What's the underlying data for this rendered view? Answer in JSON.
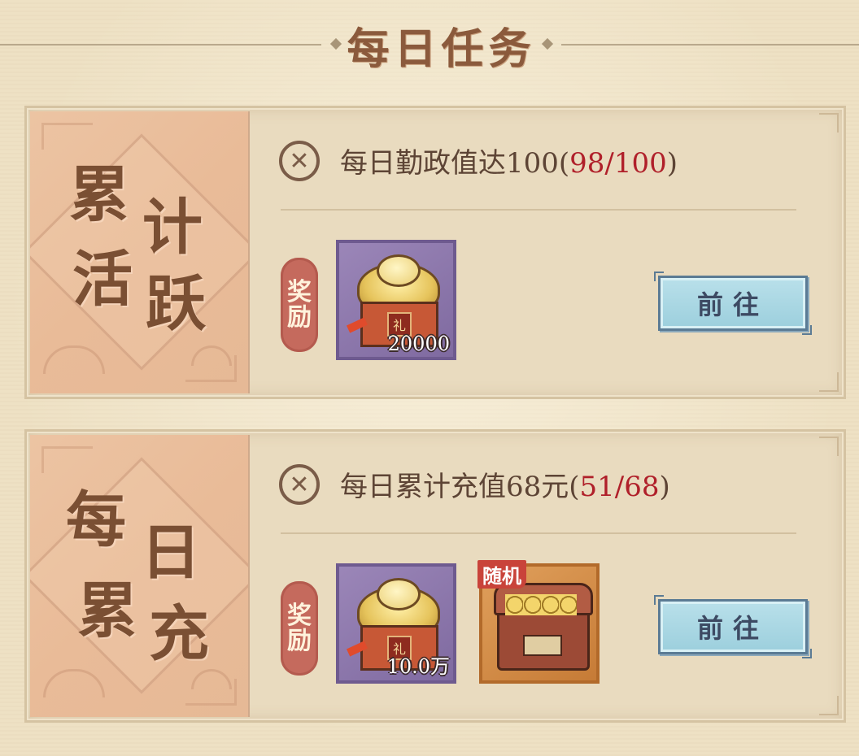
{
  "page": {
    "title": "每日任务"
  },
  "tasks": [
    {
      "banner": [
        "累",
        "计",
        "活",
        "跃"
      ],
      "status_icon": "close-circle-icon",
      "text": "每日勤政值达100(",
      "progress": "98/100",
      "text_end": ")",
      "reward_label": [
        "奖",
        "励"
      ],
      "rewards": [
        {
          "icon": "gold-ingot-gift-icon",
          "quantity": "20000",
          "rarity_color": "#8a75aa"
        }
      ],
      "button_label": "前往"
    },
    {
      "banner": [
        "每",
        "日",
        "累",
        "充"
      ],
      "status_icon": "close-circle-icon",
      "text": "每日累计充值68元(",
      "progress": "51/68",
      "text_end": ")",
      "reward_label": [
        "奖",
        "励"
      ],
      "rewards": [
        {
          "icon": "gold-ingot-gift-icon",
          "quantity": "10.0万",
          "rarity_color": "#8a75aa"
        },
        {
          "icon": "treasure-chest-icon",
          "tag": "随机",
          "rarity_color": "#d08c45"
        }
      ],
      "button_label": "前往"
    }
  ],
  "colors": {
    "progress": "#b0202a",
    "button": "#a9d8e4",
    "reward_tag": "#c56a5d"
  }
}
